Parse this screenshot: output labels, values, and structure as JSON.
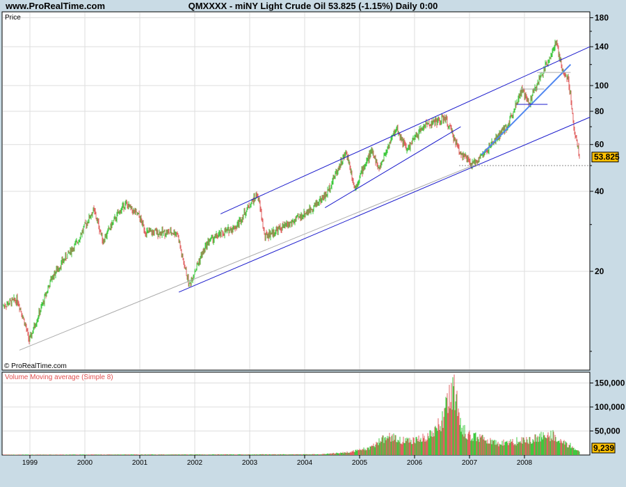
{
  "header": {
    "site": "www.ProRealTime.com",
    "title": "QMXXXX - miNY Light Crude Oil   53.825 (-1.15%)   Daily  0:00"
  },
  "price_panel": {
    "label": "Price",
    "copyright": "© ProRealTime.com",
    "last_price": "53.825"
  },
  "volume_panel": {
    "label": "Volume Moving average (Simple 8)",
    "last_value": "9,239"
  },
  "colors": {
    "up": "#3ec93e",
    "down": "#e06060",
    "trendline": "#1a1acc",
    "background": "#c9dbe5",
    "highlight": "#ffc000"
  },
  "chart_data": [
    {
      "type": "candlestick",
      "title": "QMXXXX - miNY Light Crude Oil",
      "scale": "log",
      "ylim": [
        9,
        200
      ],
      "yticks": [
        20,
        40,
        60,
        80,
        100,
        140,
        180
      ],
      "ytick_labels": [
        "20",
        "40",
        "60",
        "80",
        "100",
        "140",
        "180"
      ],
      "xticks": [
        1999,
        2000,
        2001,
        2002,
        2003,
        2004,
        2005,
        2006,
        2007,
        2008
      ],
      "xtick_labels": [
        "1999",
        "2000",
        "2001",
        "2002",
        "2003",
        "2004",
        "2005",
        "2006",
        "2007",
        "2008"
      ],
      "xlim": [
        1998.49,
        2009.19
      ],
      "path": [
        [
          1998.5,
          14.8
        ],
        [
          1998.77,
          15.7
        ],
        [
          1998.99,
          10.9
        ],
        [
          1999.22,
          14.8
        ],
        [
          1999.4,
          18.9
        ],
        [
          1999.85,
          25.5
        ],
        [
          2000.16,
          34
        ],
        [
          2000.33,
          26
        ],
        [
          2000.73,
          36
        ],
        [
          2000.99,
          32
        ],
        [
          2001.11,
          28
        ],
        [
          2001.68,
          28
        ],
        [
          2001.77,
          22.5
        ],
        [
          2001.9,
          17.7
        ],
        [
          2002.25,
          26
        ],
        [
          2002.76,
          29.6
        ],
        [
          2003.14,
          39
        ],
        [
          2003.27,
          27
        ],
        [
          2003.77,
          30.5
        ],
        [
          2004.09,
          34
        ],
        [
          2004.4,
          39
        ],
        [
          2004.76,
          56
        ],
        [
          2004.91,
          41
        ],
        [
          2005.23,
          57
        ],
        [
          2005.35,
          48
        ],
        [
          2005.67,
          69
        ],
        [
          2005.86,
          57
        ],
        [
          2006.18,
          71
        ],
        [
          2006.56,
          75
        ],
        [
          2006.81,
          57
        ],
        [
          2007.04,
          50
        ],
        [
          2007.32,
          57
        ],
        [
          2007.7,
          71
        ],
        [
          2007.95,
          96
        ],
        [
          2008.08,
          85
        ],
        [
          2008.33,
          112
        ],
        [
          2008.58,
          144
        ],
        [
          2008.68,
          115
        ],
        [
          2008.8,
          105
        ],
        [
          2008.9,
          69
        ],
        [
          2009.0,
          53.825
        ]
      ],
      "trendlines": [
        {
          "from": [
            2002.47,
            32.9
          ],
          "to": [
            2009.19,
            140
          ],
          "color": "#1a1acc"
        },
        {
          "from": [
            2001.71,
            16.7
          ],
          "to": [
            2009.19,
            76
          ],
          "color": "#1a1acc"
        },
        {
          "from": [
            1998.81,
            10.1
          ],
          "to": [
            2007.06,
            50
          ],
          "color": "#aaaaaa"
        },
        {
          "from": [
            2004.37,
            34.7
          ],
          "to": [
            2006.84,
            70
          ],
          "color": "#1a1acc"
        },
        {
          "from": [
            2007.22,
            55
          ],
          "to": [
            2008.84,
            120
          ],
          "color": "#4f86f0",
          "thick": true
        },
        {
          "from": [
            2007.86,
            85
          ],
          "to": [
            2008.42,
            85
          ],
          "color": "#1a1acc"
        },
        {
          "from": [
            2007.92,
            97
          ],
          "to": [
            2008.36,
            97
          ],
          "color": "#aaaaaa"
        },
        {
          "from": [
            2008.23,
            112
          ],
          "to": [
            2008.84,
            112
          ],
          "color": "#aaaaaa"
        }
      ],
      "dashed_level": {
        "value": 50,
        "from": 2006.81
      }
    },
    {
      "type": "bar",
      "title": "Volume Moving average (Simple 8)",
      "ylim": [
        0,
        170000
      ],
      "yticks": [
        50000,
        100000,
        150000
      ],
      "ytick_labels": [
        "50,000",
        "100,000",
        "150,000"
      ],
      "path": [
        [
          1998.5,
          800
        ],
        [
          2004.3,
          1500
        ],
        [
          2004.8,
          6000
        ],
        [
          2005.2,
          15000
        ],
        [
          2005.5,
          40000
        ],
        [
          2005.8,
          30000
        ],
        [
          2006.2,
          35000
        ],
        [
          2006.5,
          70000
        ],
        [
          2006.65,
          120000
        ],
        [
          2006.72,
          140000
        ],
        [
          2006.85,
          60000
        ],
        [
          2007.0,
          40000
        ],
        [
          2007.5,
          25000
        ],
        [
          2008.0,
          30000
        ],
        [
          2008.5,
          42000
        ],
        [
          2008.9,
          15000
        ],
        [
          2009.0,
          9239
        ]
      ]
    }
  ]
}
